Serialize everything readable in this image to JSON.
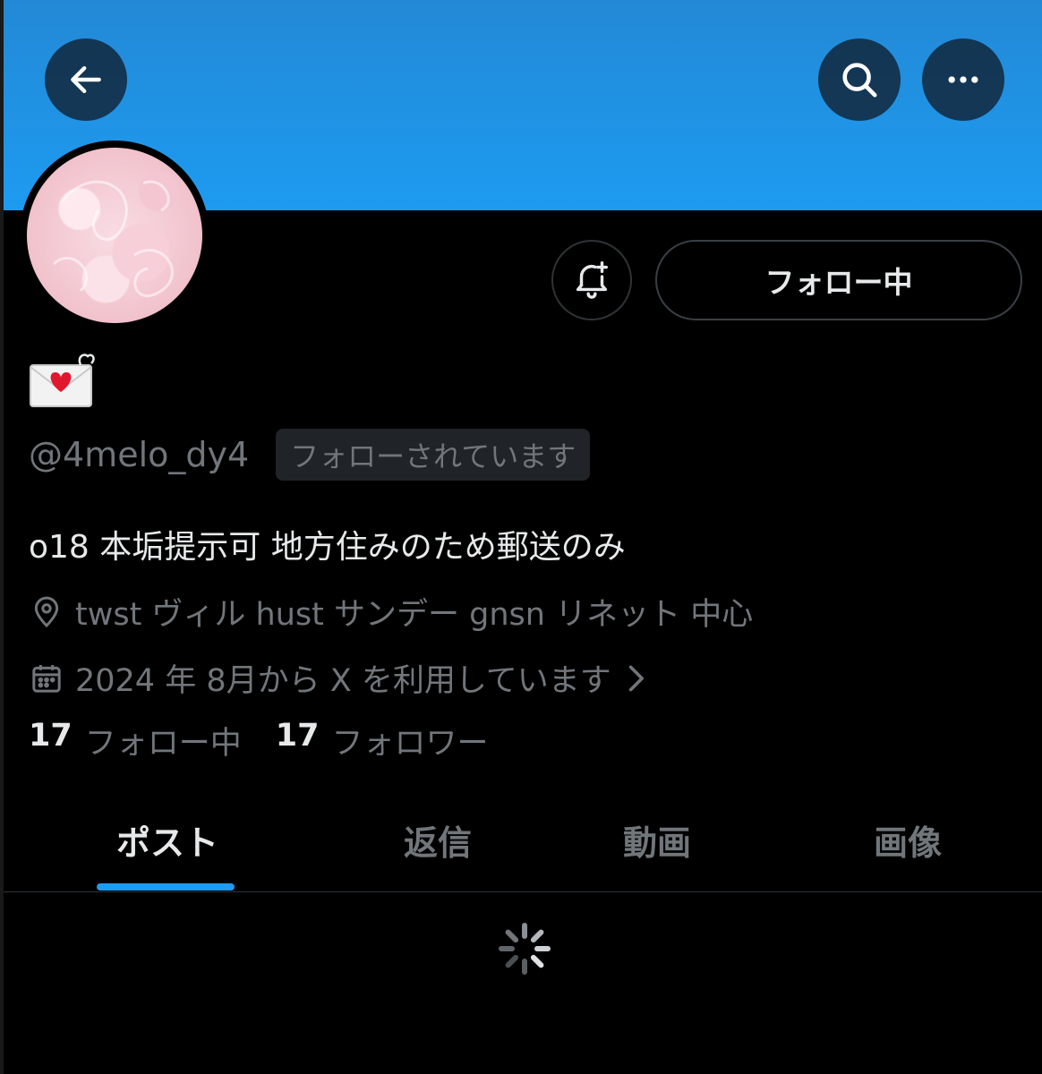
{
  "header": {
    "back_icon": "arrow-left-icon",
    "search_icon": "search-icon",
    "more_icon": "more-horizontal-icon",
    "banner_color": "#1d9bf0"
  },
  "profile": {
    "display_name_emoji": "love-letter-emoji",
    "handle": "@4melo_dy4",
    "follows_you_badge": "フォローされています",
    "bio": "o18 本垢提示可 地方住みのため郵送のみ",
    "location": "twst ヴィル hust サンデー gnsn リネット 中心",
    "joined": "2024 年 8月から X を利用しています",
    "following_count": "17",
    "following_label": "フォロー中",
    "followers_count": "17",
    "followers_label": "フォロワー"
  },
  "actions": {
    "notify_icon": "bell-plus-icon",
    "following_button": "フォロー中"
  },
  "tabs": [
    {
      "label": "ポスト",
      "active": true
    },
    {
      "label": "返信",
      "active": false
    },
    {
      "label": "動画",
      "active": false
    },
    {
      "label": "画像",
      "active": false
    }
  ],
  "accent_color": "#1d9bf0"
}
